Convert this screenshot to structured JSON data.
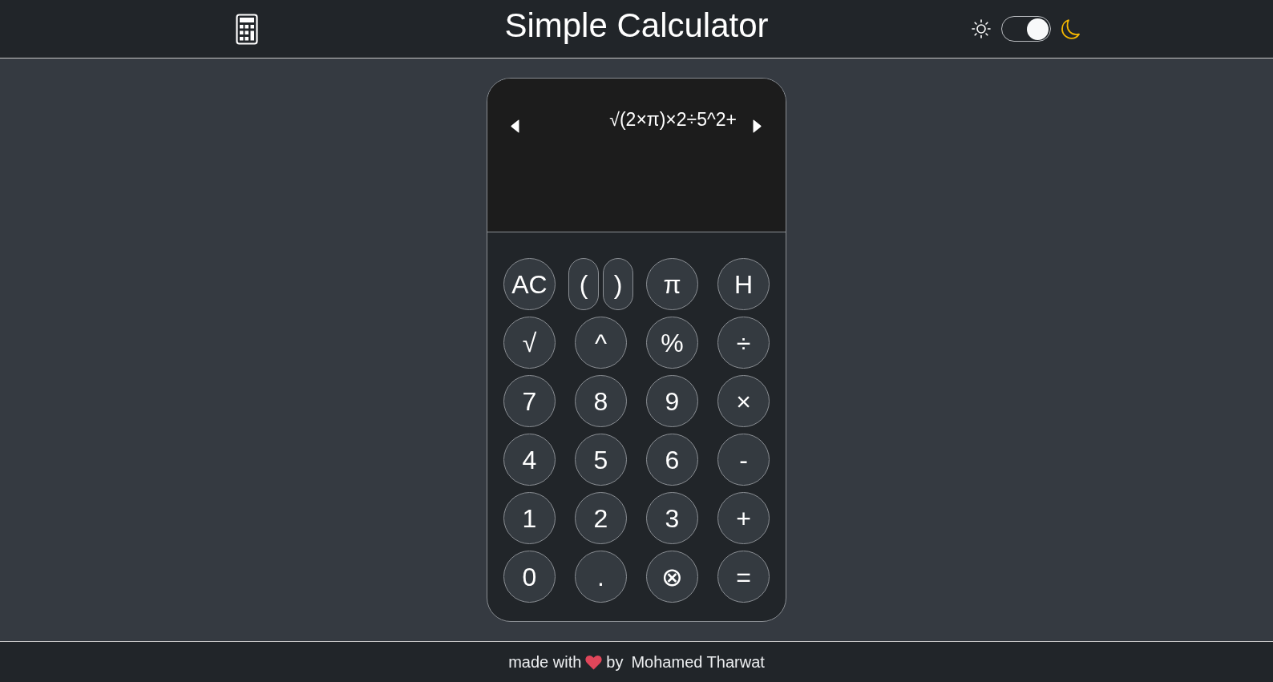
{
  "header": {
    "title": "Simple Calculator",
    "theme_switch": {
      "on": true
    }
  },
  "display": {
    "expression": "√(2×π)×2÷5^2+"
  },
  "keypad": {
    "rows": [
      [
        {
          "kind": "circle",
          "label": "AC"
        },
        {
          "kind": "pair",
          "keys": [
            {
              "label": "("
            },
            {
              "label": ")"
            }
          ]
        },
        {
          "kind": "circle",
          "label": "π"
        },
        {
          "kind": "circle",
          "label": "H"
        }
      ],
      [
        {
          "kind": "circle",
          "label": "√"
        },
        {
          "kind": "circle",
          "label": "^"
        },
        {
          "kind": "circle",
          "label": "%"
        },
        {
          "kind": "circle",
          "label": "÷"
        }
      ],
      [
        {
          "kind": "circle",
          "label": "7"
        },
        {
          "kind": "circle",
          "label": "8"
        },
        {
          "kind": "circle",
          "label": "9"
        },
        {
          "kind": "circle",
          "label": "×"
        }
      ],
      [
        {
          "kind": "circle",
          "label": "4"
        },
        {
          "kind": "circle",
          "label": "5"
        },
        {
          "kind": "circle",
          "label": "6"
        },
        {
          "kind": "circle",
          "label": "-"
        }
      ],
      [
        {
          "kind": "circle",
          "label": "1"
        },
        {
          "kind": "circle",
          "label": "2"
        },
        {
          "kind": "circle",
          "label": "3"
        },
        {
          "kind": "circle",
          "label": "+"
        }
      ],
      [
        {
          "kind": "circle",
          "label": "0"
        },
        {
          "kind": "circle",
          "label": "."
        },
        {
          "kind": "circle",
          "label": "⊗"
        },
        {
          "kind": "circle",
          "label": "="
        }
      ]
    ]
  },
  "footer": {
    "made_with": "made with",
    "by": "by",
    "author": "Mohamed Tharwat"
  }
}
